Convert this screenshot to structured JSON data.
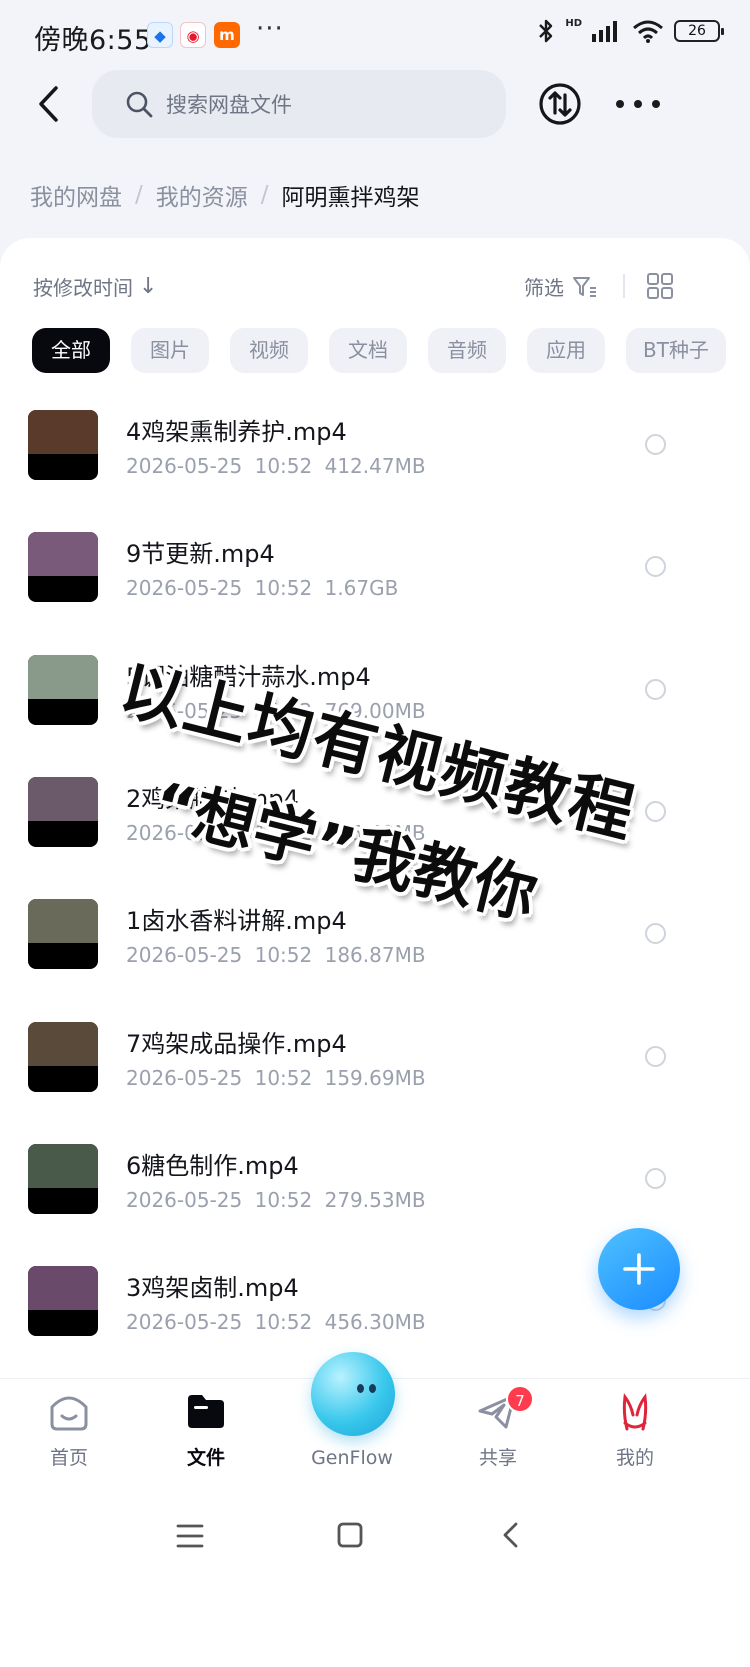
{
  "status_bar": {
    "time": "傍晚6:55",
    "app_icons": [
      "baidu-app-icon",
      "weibo-icon",
      "mi-icon"
    ],
    "more": "···",
    "hd": "HD",
    "battery": "26"
  },
  "header": {
    "search_placeholder": "搜索网盘文件"
  },
  "breadcrumb": {
    "items": [
      "我的网盘",
      "我的资源"
    ],
    "current": "阿明熏拌鸡架"
  },
  "toolbar": {
    "sort_label": "按修改时间",
    "sort_arrow": "↓",
    "filter_label": "筛选"
  },
  "chips": [
    "全部",
    "图片",
    "视频",
    "文档",
    "音频",
    "应用",
    "BT种子"
  ],
  "files": [
    {
      "name": "4鸡架熏制养护.mp4",
      "date": "2026-05-25",
      "time": "10:52",
      "size": "412.47MB",
      "thumb": "#5a3a2a"
    },
    {
      "name": "9节更新.mp4",
      "date": "2026-05-25",
      "time": "10:52",
      "size": "1.67GB",
      "thumb": "#7a5a7a"
    },
    {
      "name": "5调油糖醋汁蒜水.mp4",
      "date": "2026-05-25",
      "time": "10:52",
      "size": "769.00MB",
      "thumb": "#8a9a8a"
    },
    {
      "name": "2鸡架腌制.mp4",
      "date": "2026-05-25",
      "time": "10:52",
      "size": "215.40MB",
      "thumb": "#6a5a6a"
    },
    {
      "name": "1卤水香料讲解.mp4",
      "date": "2026-05-25",
      "time": "10:52",
      "size": "186.87MB",
      "thumb": "#6a6a5a"
    },
    {
      "name": "7鸡架成品操作.mp4",
      "date": "2026-05-25",
      "time": "10:52",
      "size": "159.69MB",
      "thumb": "#5a4a3a"
    },
    {
      "name": "6糖色制作.mp4",
      "date": "2026-05-25",
      "time": "10:52",
      "size": "279.53MB",
      "thumb": "#4a5a4a"
    },
    {
      "name": "3鸡架卤制.mp4",
      "date": "2026-05-25",
      "time": "10:52",
      "size": "456.30MB",
      "thumb": "#6a4a6a"
    }
  ],
  "overlay": {
    "line1": "以上均有视频教程",
    "line2": "“想学”我教你"
  },
  "bottom_nav": {
    "home": "首页",
    "files": "文件",
    "genflow": "GenFlow",
    "share": "共享",
    "share_badge": "7",
    "mine": "我的"
  },
  "colors": {
    "accent": "#1a8cff",
    "active_chip": "#07090f",
    "badge": "#ff3b4e"
  }
}
